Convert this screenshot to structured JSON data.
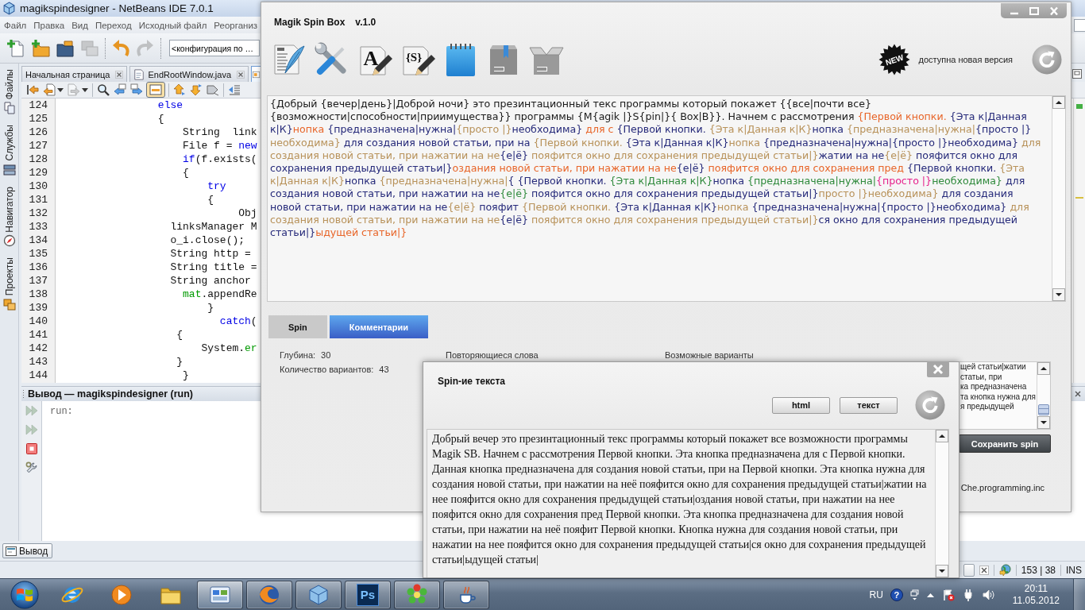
{
  "netbeans": {
    "title": "magikspindesigner - NetBeans IDE 7.0.1",
    "menu": [
      "Файл",
      "Правка",
      "Вид",
      "Переход",
      "Исходный файл",
      "Реорганиз"
    ],
    "toolbar": [
      {
        "items": [
          {
            "kind": "new-file",
            "disabled": false
          },
          {
            "kind": "new-project",
            "disabled": false
          },
          {
            "kind": "open-project",
            "disabled": false
          },
          {
            "kind": "close-project",
            "disabled": true
          }
        ]
      },
      {
        "items": [
          {
            "kind": "undo",
            "disabled": false
          },
          {
            "kind": "redo",
            "disabled": true
          }
        ]
      }
    ],
    "config": "<конфигурация по …",
    "side_tabs": [
      {
        "kind": "files",
        "label": "Файлы"
      },
      {
        "kind": "services",
        "label": "Службы"
      },
      {
        "kind": "navigator",
        "label": "Навигатор"
      },
      {
        "kind": "projects",
        "label": "Проекты"
      }
    ],
    "editor_tabs": [
      {
        "kind": "start",
        "label": "Начальная страница",
        "selected": false
      },
      {
        "kind": "java",
        "label": "EndRootWindow.java",
        "selected": false
      },
      {
        "kind": "form",
        "selected": true
      }
    ],
    "editor_toolbar": [
      {
        "items": [
          {
            "kind": "last-edit",
            "disabled": false,
            "selected": false
          },
          {
            "kind": "back",
            "disabled": false,
            "selected": false
          },
          {
            "kind": "caret",
            "disabled": false,
            "selected": false
          },
          {
            "kind": "forward",
            "disabled": true,
            "selected": false
          },
          {
            "kind": "caret",
            "disabled": false,
            "selected": false
          }
        ]
      },
      {
        "items": [
          {
            "kind": "find",
            "disabled": false,
            "selected": false
          },
          {
            "kind": "find-prev",
            "disabled": false,
            "selected": false
          },
          {
            "kind": "find-next",
            "disabled": false,
            "selected": false
          },
          {
            "kind": "highlight",
            "disabled": false,
            "selected": true
          }
        ]
      },
      {
        "items": [
          {
            "kind": "prev-bookmark",
            "disabled": false,
            "selected": false
          },
          {
            "kind": "next-bookmark",
            "disabled": false,
            "selected": false
          },
          {
            "kind": "toggle-bookmark",
            "disabled": false,
            "selected": false
          }
        ]
      },
      {
        "items": [
          {
            "kind": "shift-left",
            "disabled": false,
            "selected": false
          }
        ]
      }
    ],
    "code": [
      {
        "number": "124",
        "tokens": [
          {
            "text": "                else",
            "kind": "keyword"
          }
        ]
      },
      {
        "number": "125",
        "tokens": [
          {
            "text": "                {",
            "kind": "plain"
          }
        ]
      },
      {
        "number": "126",
        "tokens": [
          {
            "text": "                    String  link",
            "kind": "plain"
          }
        ]
      },
      {
        "number": "127",
        "tokens": [
          {
            "text": "                    File f = ",
            "kind": "plain"
          },
          {
            "text": "new",
            "kind": "keyword"
          }
        ]
      },
      {
        "number": "128",
        "tokens": [
          {
            "text": "                    if",
            "kind": "keyword"
          },
          {
            "text": "(f.exists(",
            "kind": "plain"
          }
        ]
      },
      {
        "number": "129",
        "tokens": [
          {
            "text": "                    {",
            "kind": "plain"
          }
        ]
      },
      {
        "number": "130",
        "tokens": [
          {
            "text": "                        try",
            "kind": "keyword"
          }
        ]
      },
      {
        "number": "131",
        "tokens": [
          {
            "text": "                        {",
            "kind": "plain"
          }
        ]
      },
      {
        "number": "132",
        "tokens": [
          {
            "text": "                             Obj",
            "kind": "plain"
          }
        ]
      },
      {
        "number": "133",
        "tokens": [
          {
            "text": "                  linksManager M",
            "kind": "plain"
          }
        ]
      },
      {
        "number": "134",
        "tokens": [
          {
            "text": "                  o_i.close();",
            "kind": "plain"
          }
        ]
      },
      {
        "number": "135",
        "tokens": [
          {
            "text": "                  String http =",
            "kind": "plain"
          }
        ]
      },
      {
        "number": "136",
        "tokens": [
          {
            "text": "                  String title =",
            "kind": "plain"
          }
        ]
      },
      {
        "number": "137",
        "tokens": [
          {
            "text": "                  String anchor",
            "kind": "plain"
          }
        ]
      },
      {
        "number": "138",
        "tokens": [
          {
            "text": "                    mat",
            "kind": "field"
          },
          {
            "text": ".appendRe",
            "kind": "plain"
          }
        ]
      },
      {
        "number": "139",
        "tokens": [
          {
            "text": "                        }",
            "kind": "plain"
          }
        ]
      },
      {
        "number": "140",
        "tokens": [
          {
            "text": "                          catch",
            "kind": "keyword"
          },
          {
            "text": "(",
            "kind": "plain"
          }
        ]
      },
      {
        "number": "141",
        "tokens": [
          {
            "text": "                   {",
            "kind": "plain"
          }
        ]
      },
      {
        "number": "142",
        "tokens": [
          {
            "text": "                       System.",
            "kind": "plain"
          },
          {
            "text": "er",
            "kind": "field"
          }
        ]
      },
      {
        "number": "143",
        "tokens": [
          {
            "text": "                   }",
            "kind": "plain"
          }
        ]
      },
      {
        "number": "144",
        "tokens": [
          {
            "text": "                    }",
            "kind": "plain"
          }
        ]
      }
    ],
    "output": {
      "title": "Вывод — magikspindesigner (run)",
      "actions": [
        {
          "kind": "rerun",
          "disabled": true
        },
        {
          "kind": "rerun-config",
          "disabled": true
        },
        {
          "kind": "stop",
          "disabled": false
        },
        {
          "kind": "settings",
          "disabled": false
        }
      ],
      "lines": [
        "run:"
      ]
    },
    "minimized": [
      "Вывод"
    ],
    "status": {
      "position": "153 | 38",
      "mode": "INS"
    }
  },
  "magik": {
    "title": "Magik Spin Box",
    "version": "v.1.0",
    "tools": [
      {
        "kind": "blog"
      },
      {
        "kind": "tools"
      },
      {
        "kind": "letter",
        "label": "A"
      },
      {
        "kind": "letter",
        "label": "{S}"
      },
      {
        "kind": "notepad"
      },
      {
        "kind": "box"
      },
      {
        "kind": "open-box"
      }
    ],
    "update": {
      "badge": "NEW",
      "text": "доступна новая версия"
    },
    "source": [
      {
        "text": "{Добрый {вечер|день}|Доброй ночи} это презинтационный текс программы который покажет {{все|почти все} {возможности|способности|приимущества}} программы {M{agik |}S{pin|}{ Box|B}}. Начнем с рассмотрения ",
        "color": "#1a1a1a"
      },
      {
        "text": "{Первой кнопки. ",
        "color": "#e8662a"
      },
      {
        "text": "{Эта к|Данная к|К}",
        "color": "#262a7a"
      },
      {
        "text": "нопка ",
        "color": "#e8662a"
      },
      {
        "text": "{предназначена|нужна|",
        "color": "#262a7a"
      },
      {
        "text": "{просто |}",
        "color": "#b8925a"
      },
      {
        "text": "необходима}",
        "color": "#262a7a"
      },
      {
        "text": " для с ",
        "color": "#e8662a"
      },
      {
        "text": "{Первой кнопки. ",
        "color": "#262a7a"
      },
      {
        "text": "{Эта к|Данная к|К}",
        "color": "#b8925a"
      },
      {
        "text": "нопка ",
        "color": "#262a7a"
      },
      {
        "text": "{предназначена|нужна|",
        "color": "#b8925a"
      },
      {
        "text": "{просто |}",
        "color": "#262a7a"
      },
      {
        "text": "необходима}",
        "color": "#b8925a"
      },
      {
        "text": " для создания новой статьи, при на ",
        "color": "#262a7a"
      },
      {
        "text": "{Первой кнопки. ",
        "color": "#b8925a"
      },
      {
        "text": "{Эта к|Данная к|К}",
        "color": "#262a7a"
      },
      {
        "text": "нопка ",
        "color": "#b8925a"
      },
      {
        "text": "{предназначена|нужна|{просто |}необходима}",
        "color": "#262a7a"
      },
      {
        "text": " для создания новой статьи, при нажатии на не",
        "color": "#b8925a"
      },
      {
        "text": "{е|ё}",
        "color": "#262a7a"
      },
      {
        "text": " пояфится окно для сохранения предыдущей статьи|}",
        "color": "#b8925a"
      },
      {
        "text": "жатии на не",
        "color": "#262a7a"
      },
      {
        "text": "{е|ё}",
        "color": "#b8925a"
      },
      {
        "text": " пояфится окно для сохранения предыдущей статьи|}",
        "color": "#262a7a"
      },
      {
        "text": "оздания новой статьи, при нажатии на не",
        "color": "#e8662a"
      },
      {
        "text": "{е|ё}",
        "color": "#262a7a"
      },
      {
        "text": " пояфится окно для сохранения пред ",
        "color": "#e8662a"
      },
      {
        "text": "{Первой кнопки. ",
        "color": "#262a7a"
      },
      {
        "text": "{Эта к|Данная к|К}",
        "color": "#b8925a"
      },
      {
        "text": "нопка ",
        "color": "#262a7a"
      },
      {
        "text": "{предназначена|нужна|",
        "color": "#b8925a"
      },
      {
        "text": "{ {Первой кнопки. ",
        "color": "#262a7a"
      },
      {
        "text": "{Эта к|Данная к|К}",
        "color": "#2f8a3c"
      },
      {
        "text": "нопка ",
        "color": "#262a7a"
      },
      {
        "text": "{предназначена|нужна|",
        "color": "#2f8a3c"
      },
      {
        "text": "{просто |}",
        "color": "#e6228c"
      },
      {
        "text": "необходима}",
        "color": "#2f8a3c"
      },
      {
        "text": " для создания новой статьи, при нажатии на не",
        "color": "#262a7a"
      },
      {
        "text": "{е|ё}",
        "color": "#2f8a3c"
      },
      {
        "text": " пояфится окно для сохранения предыдущей статьи|}",
        "color": "#262a7a"
      },
      {
        "text": "просто |}необходима}",
        "color": "#b8925a"
      },
      {
        "text": " для создания новой статьи, при нажатии на не",
        "color": "#262a7a"
      },
      {
        "text": "{е|ё}",
        "color": "#b8925a"
      },
      {
        "text": " пояфит ",
        "color": "#262a7a"
      },
      {
        "text": "{Первой кнопки. ",
        "color": "#b8925a"
      },
      {
        "text": "{Эта к|Данная к|К}",
        "color": "#262a7a"
      },
      {
        "text": "нопка ",
        "color": "#b8925a"
      },
      {
        "text": "{предназначена|нужна|{просто |}необходима}",
        "color": "#262a7a"
      },
      {
        "text": " для создания новой статьи, при нажатии на не",
        "color": "#b8925a"
      },
      {
        "text": "{е|ё}",
        "color": "#262a7a"
      },
      {
        "text": " пояфится окно для сохранения предыдущей статьи|}",
        "color": "#b8925a"
      },
      {
        "text": "ся окно для сохранения предыдущей статьи|}",
        "color": "#262a7a"
      },
      {
        "text": "ыдущей статьи|}",
        "color": "#e8662a"
      }
    ],
    "tabs": [
      {
        "label": "Spin",
        "selected": false
      },
      {
        "label": "Комментарии",
        "selected": true
      }
    ],
    "stats": [
      {
        "label": "Глубина:",
        "value": "30"
      },
      {
        "label": "Количество вариантов:",
        "value": "43"
      }
    ],
    "columns": [
      "Повторяющиеся слова",
      "Возможные варианты"
    ],
    "variants": [
      "щей статьи|жатии",
      "статьи, при",
      "ка предназначена",
      "та кнопка нужна для",
      "я предыдущей"
    ],
    "save_button": "Сохранить spin",
    "footer": "Che.programming.inc"
  },
  "dialog": {
    "title": "Spin-ие текста",
    "buttons": [
      "html",
      "текст"
    ],
    "text": "Добрый вечер это презинтационный текс программы который покажет все возможности программы Magik SB. Начнем с рассмотрения Первой кнопки. Эта кнопка предназначена для с Первой кнопки. Данная кнопка предназначена для создания новой статьи, при на Первой кнопки. Эта кнопка нужна для создания новой статьи, при нажатии на неё пояфится окно для сохранения предыдущей статьи|жатии на нее пояфится окно для сохранения предыдущей статьи|оздания новой статьи, при нажатии на нее пояфится окно для сохранения пред Первой кнопки. Эта кнопка предназначена для создания новой статьи, при нажатии на неё пояфит Первой кнопки. Кнопка нужна для создания новой статьи, при нажатии на нее пояфится окно для сохранения предыдущей статьи|ся окно для сохранения предыдущей статьи|ыдущей статьи|"
  },
  "taskbar": {
    "apps": [
      {
        "kind": "ie",
        "open": false,
        "selected": false
      },
      {
        "kind": "media",
        "open": false,
        "selected": false
      },
      {
        "kind": "folder",
        "open": false,
        "selected": false
      },
      {
        "kind": "control",
        "open": true,
        "selected": true
      },
      {
        "kind": "firefox",
        "open": true,
        "selected": false
      },
      {
        "kind": "cube",
        "open": true,
        "selected": false
      },
      {
        "kind": "photoshop",
        "label": "Ps",
        "open": true,
        "selected": false
      },
      {
        "kind": "icq",
        "open": true,
        "selected": false
      },
      {
        "kind": "java",
        "open": true,
        "selected": false
      }
    ],
    "language": "RU",
    "help": "?",
    "time": "20:11",
    "date": "11.05.2012"
  }
}
